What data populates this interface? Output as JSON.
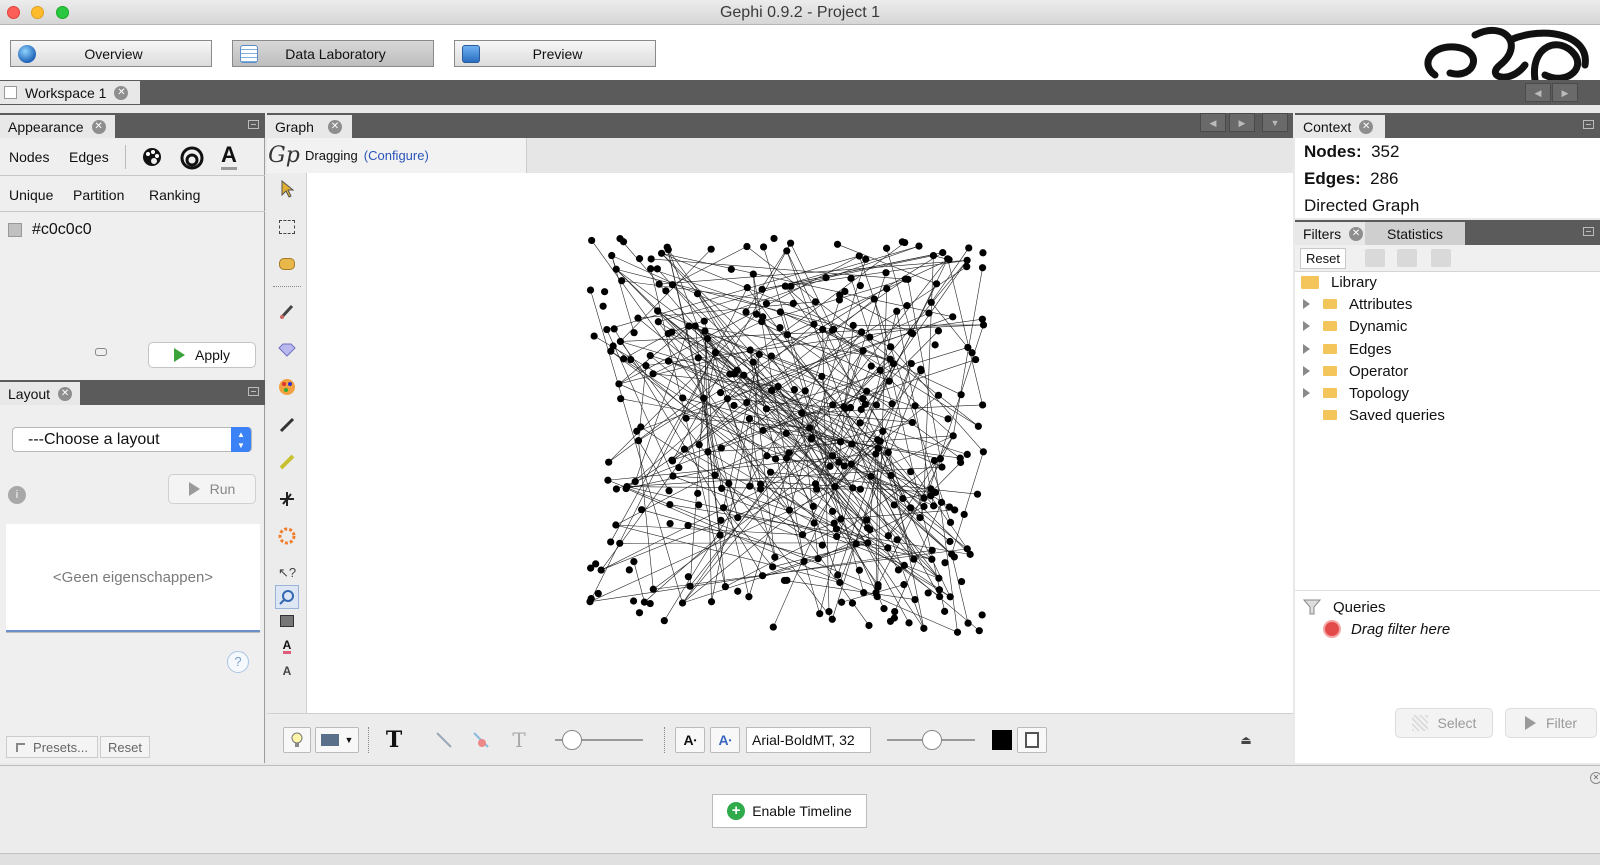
{
  "window": {
    "title": "Gephi 0.9.2 - Project 1"
  },
  "modes": [
    {
      "label": "Overview",
      "icon": "globe-icon",
      "active": false
    },
    {
      "label": "Data Laboratory",
      "icon": "table-icon",
      "active": true
    },
    {
      "label": "Preview",
      "icon": "monitor-icon",
      "active": false
    }
  ],
  "workspace": {
    "tab_label": "Workspace 1"
  },
  "appearance": {
    "title": "Appearance",
    "tabs": [
      "Nodes",
      "Edges"
    ],
    "modes": [
      "Unique",
      "Partition",
      "Ranking"
    ],
    "color_value": "#c0c0c0",
    "apply_label": "Apply"
  },
  "layout_panel": {
    "title": "Layout",
    "select_value": "---Choose a layout",
    "run_label": "Run",
    "properties_placeholder": "<Geen eigenschappen>",
    "presets_label": "Presets...",
    "reset_label": "Reset"
  },
  "graph_panel": {
    "title": "Graph",
    "tool_status": "Dragging",
    "configure_link": "(Configure)",
    "node_count": 352,
    "font_field": "Arial-BoldMT, 32"
  },
  "context": {
    "title": "Context",
    "nodes_label": "Nodes:",
    "nodes_value": "352",
    "edges_label": "Edges:",
    "edges_value": "286",
    "graph_type": "Directed Graph"
  },
  "filters": {
    "title": "Filters",
    "statistics_tab": "Statistics",
    "reset_label": "Reset",
    "library_label": "Library",
    "tree": [
      "Attributes",
      "Dynamic",
      "Edges",
      "Operator",
      "Topology",
      "Saved queries"
    ],
    "queries_label": "Queries",
    "drag_hint": "Drag filter here",
    "select_label": "Select",
    "filter_label": "Filter"
  },
  "timeline": {
    "enable_label": "Enable Timeline"
  }
}
